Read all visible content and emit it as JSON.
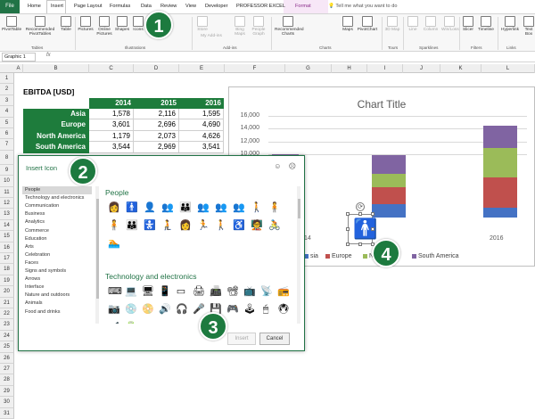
{
  "tabs": [
    "File",
    "Home",
    "Insert",
    "Page Layout",
    "Formulas",
    "Data",
    "Review",
    "View",
    "Developer",
    "PROFESSOR EXCEL",
    "Format",
    "Tell me what you want to do"
  ],
  "ribbon": {
    "buttons": [
      "PivotTable",
      "Recommended PivotTables",
      "Table",
      "Pictures",
      "Online Pictures",
      "Shapes",
      "Icons",
      "Store",
      "My Add-ins",
      "Bing Maps",
      "People Graph",
      "Recommended Charts",
      "Maps",
      "PivotChart",
      "3D Map",
      "Line",
      "Column",
      "Win/Loss",
      "Slicer",
      "Timeline",
      "Hyperlink",
      "Text Box"
    ],
    "groups": [
      "Tables",
      "Illustrations",
      "Add-ins",
      "Charts",
      "Tours",
      "Sparklines",
      "Filters",
      "Links"
    ]
  },
  "namebox": "Graphic 1",
  "fx": "fx",
  "columns": [
    "A",
    "B",
    "C",
    "D",
    "E",
    "F",
    "G",
    "H",
    "I",
    "J",
    "K",
    "L"
  ],
  "rows": [
    "1",
    "2",
    "3",
    "4",
    "5",
    "6",
    "7",
    "8",
    "9",
    "10",
    "11",
    "12",
    "13",
    "14",
    "15",
    "16",
    "17",
    "18",
    "19",
    "20",
    "21",
    "22",
    "23",
    "24",
    "25",
    "26",
    "27",
    "28",
    "29",
    "30",
    "31"
  ],
  "table": {
    "title": "EBITDA [USD]",
    "years": [
      "2014",
      "2015",
      "2016"
    ],
    "rows": [
      {
        "region": "Asia",
        "v": [
          "1,578",
          "2,116",
          "1,595"
        ]
      },
      {
        "region": "Europe",
        "v": [
          "3,601",
          "2,696",
          "4,690"
        ]
      },
      {
        "region": "North America",
        "v": [
          "1,179",
          "2,073",
          "4,626"
        ]
      },
      {
        "region": "South America",
        "v": [
          "3,544",
          "2,969",
          "3,541"
        ]
      }
    ]
  },
  "chart_data": {
    "type": "bar",
    "title": "Chart Title",
    "stacked": true,
    "categories": [
      "2014",
      "2015",
      "2016"
    ],
    "visible_category_labels": [
      "14",
      "2016"
    ],
    "series": [
      {
        "name": "Asia",
        "color": "#4472c4",
        "values": [
          1578,
          2116,
          1595
        ]
      },
      {
        "name": "Europe",
        "color": "#c0504d",
        "values": [
          3601,
          2696,
          4690
        ]
      },
      {
        "name": "North America",
        "color": "#9bbb59",
        "values": [
          1179,
          2073,
          4626
        ]
      },
      {
        "name": "South America",
        "color": "#8064a2",
        "values": [
          3544,
          2969,
          3541
        ]
      }
    ],
    "yticks": [
      "16,000",
      "14,000",
      "12,000",
      "10,000"
    ],
    "ylim": [
      0,
      16000
    ],
    "legend": "bottom",
    "grid": true,
    "legend_visible": [
      "sia",
      "Europe",
      "No",
      "South America"
    ]
  },
  "dialog": {
    "title": "Insert Icon",
    "smileys": "☺ ☹",
    "categories": [
      "People",
      "Technology and electronics",
      "Communication",
      "Business",
      "Analytics",
      "Commerce",
      "Education",
      "Arts",
      "Celebration",
      "Faces",
      "Signs and symbols",
      "Arrows",
      "Interface",
      "Nature and outdoors",
      "Animals",
      "Food and drinks"
    ],
    "selected_category": "People",
    "sections": [
      "People",
      "Technology and electronics"
    ],
    "people_icons": [
      "👩",
      "🚹",
      "👤",
      "👥",
      "👪",
      "👥",
      "👥",
      "👥",
      "🚶",
      "🧍",
      "🧍",
      "👪",
      "🚼",
      "🧎",
      "👩",
      "🏃",
      "🚶",
      "♿",
      "🧑‍🏫",
      "🚴",
      "🏊"
    ],
    "tech_icons": [
      "⌨",
      "💻",
      "🖥",
      "📱",
      "▭",
      "🖨",
      "📠",
      "📽",
      "📺",
      "📡",
      "📻",
      "📷",
      "💿",
      "📀",
      "🔊",
      "🎧",
      "🎤",
      "💾",
      "🎮",
      "🕹",
      "🖱",
      "🖲",
      "📹",
      "🔋"
    ],
    "insert_label": "Insert",
    "cancel_label": "Cancel"
  },
  "callouts": [
    "1",
    "2",
    "3",
    "4"
  ]
}
